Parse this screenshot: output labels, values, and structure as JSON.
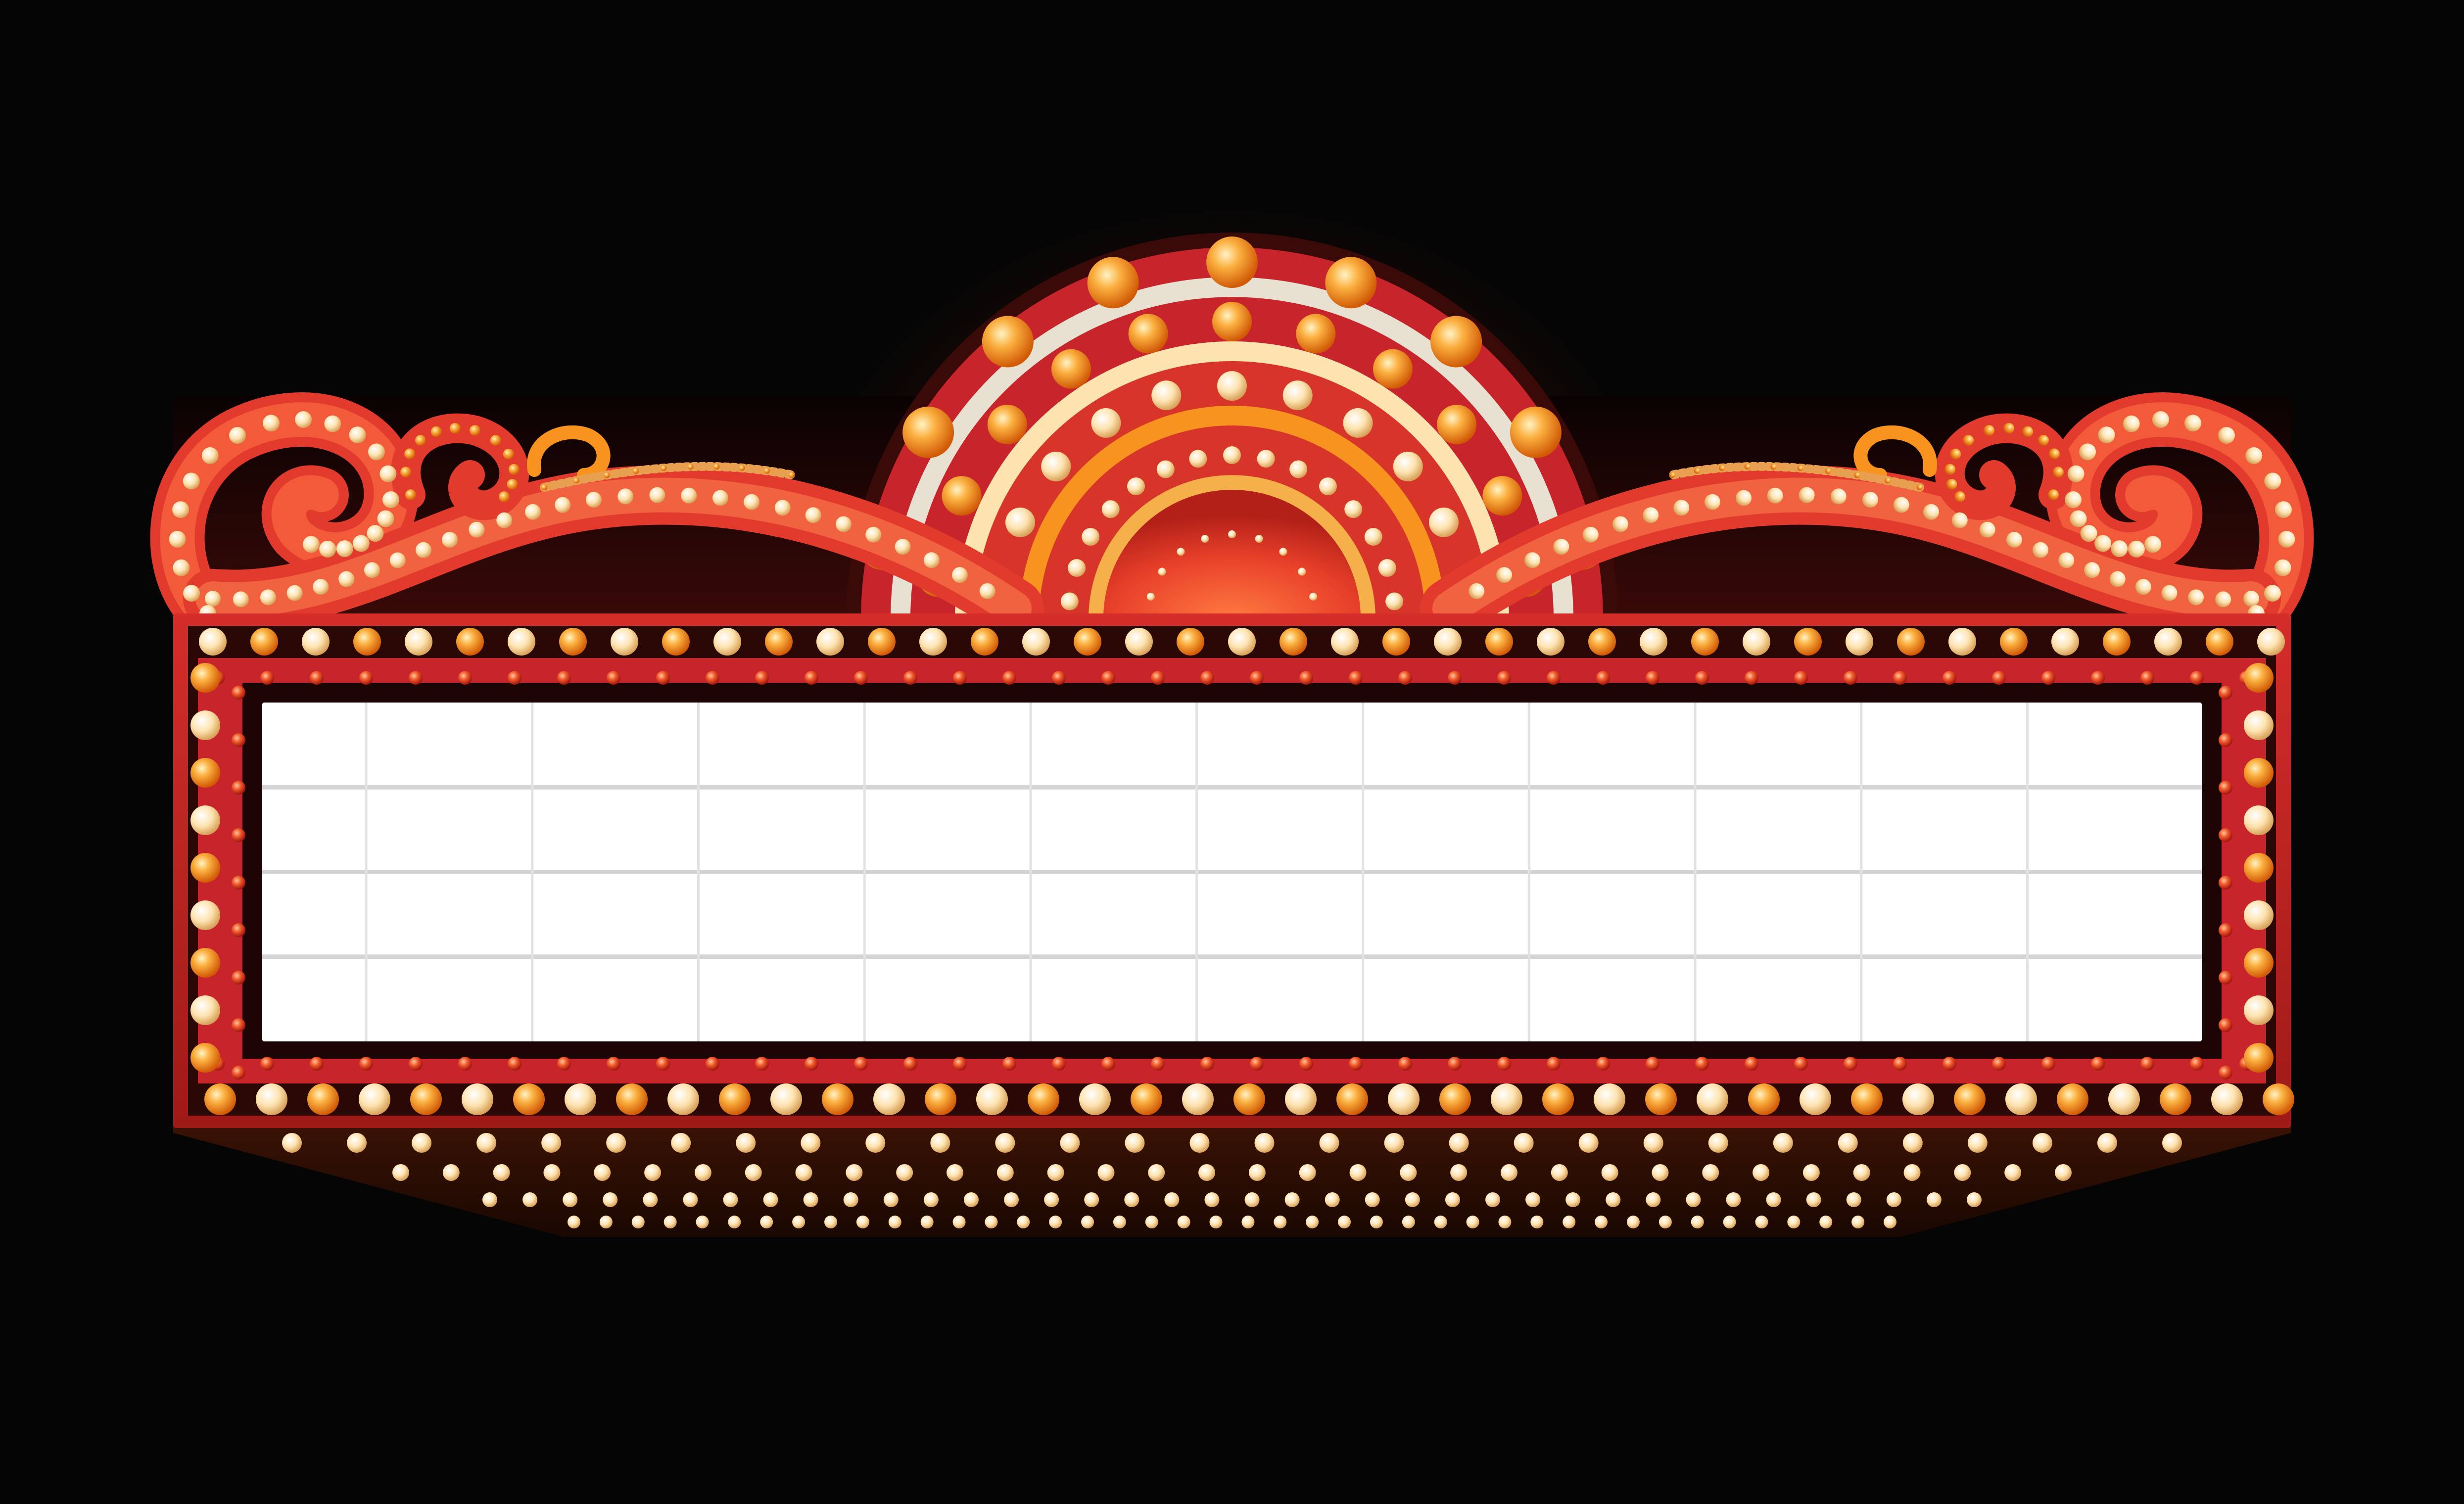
{
  "marquee": {
    "board": {
      "rows": 4,
      "columns": 12,
      "letters": []
    },
    "colors": {
      "background": "#050505",
      "frame_red": "#c8242b",
      "frame_dark": "#2a0806",
      "bulb_orange": "#f7931e",
      "bulb_cream": "#fde3b0",
      "bulb_red": "#e8402a",
      "board_white": "#ffffff",
      "grid_line": "#d4d4d4",
      "glow": "#ff7a1a"
    },
    "icons": {
      "sunburst": "sunburst-arch-icon",
      "scroll_left": "scroll-left-icon",
      "scroll_right": "scroll-right-icon",
      "bulb": "light-bulb-icon"
    }
  }
}
